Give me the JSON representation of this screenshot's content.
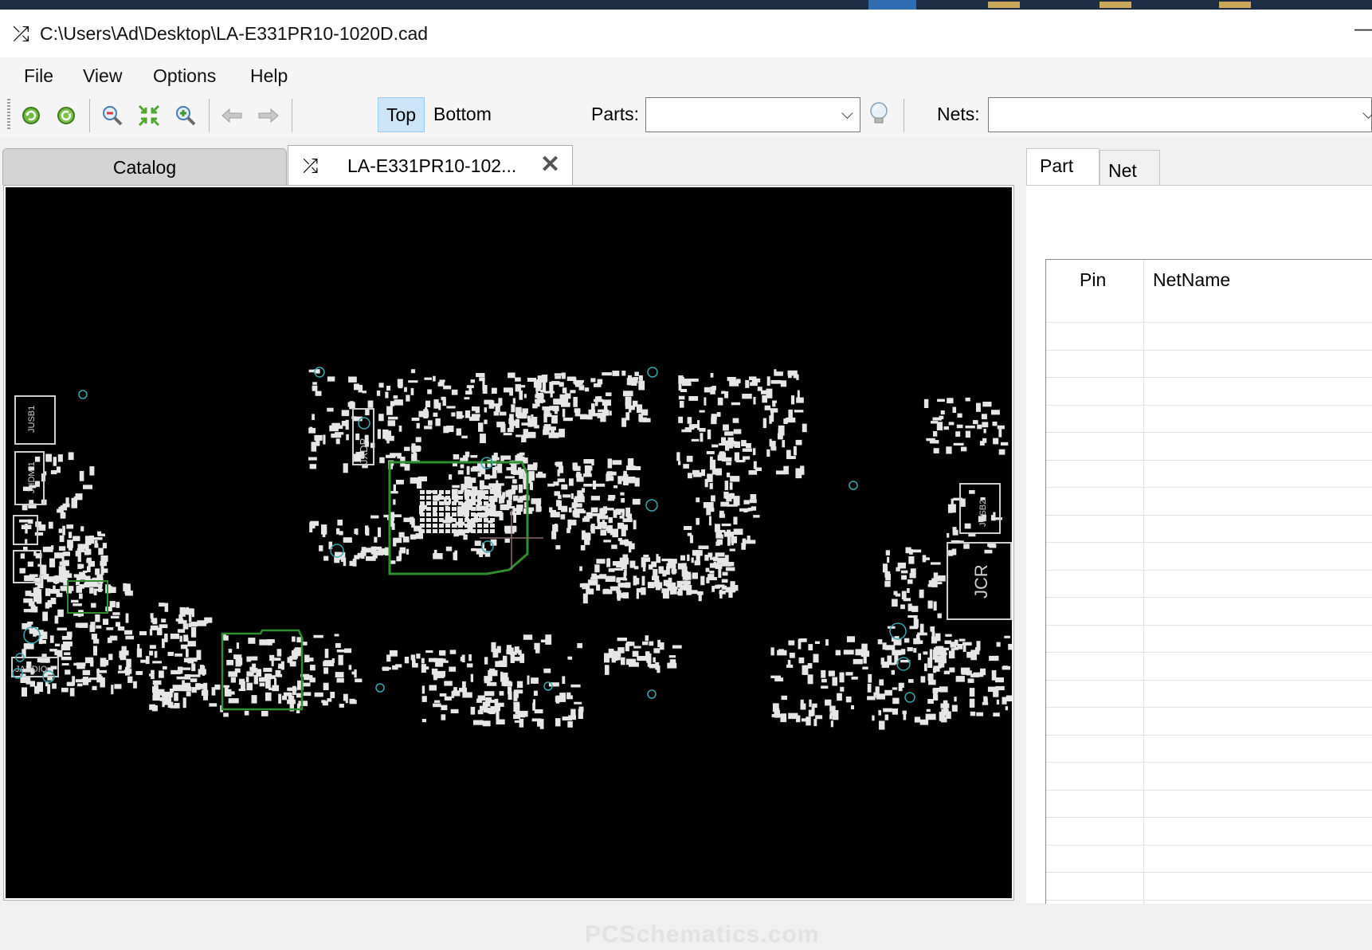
{
  "window": {
    "title": "C:\\Users\\Ad\\Desktop\\LA-E331PR10-1020D.cad",
    "app_icon": "shuffle-icon"
  },
  "menu": [
    "File",
    "View",
    "Options",
    "Help"
  ],
  "toolbar": {
    "buttons": [
      "refresh-icon",
      "reload-icon",
      "zoom-out-icon",
      "fit-icon",
      "zoom-in-icon",
      "back-arrow-icon",
      "forward-arrow-icon"
    ],
    "side_top": "Top",
    "side_bottom": "Bottom",
    "active_side": "Top",
    "parts_label": "Parts:",
    "parts_value": "",
    "nets_label": "Nets:",
    "nets_value": "",
    "highlight_icon": "lightbulb-icon"
  },
  "tabs": {
    "catalog": "Catalog",
    "document": "LA-E331PR10-102...",
    "close_icon": "close-icon"
  },
  "board_labels": [
    "JUSB1",
    "JHDMI1",
    "JAUDIO",
    "JXDP",
    "JUSB2",
    "JCR"
  ],
  "side_panel": {
    "tabs": [
      "Part",
      "Net"
    ],
    "active_tab": "Part",
    "columns": [
      "Pin",
      "NetName"
    ],
    "rows": []
  },
  "watermark": "PCSchematics.com",
  "colors": {
    "board_background": "#000000",
    "component": "#e6e6e6",
    "outline_green": "#2f8f2f",
    "via_cyan": "#3aa7b0",
    "active_toggle": "#cce4f7"
  }
}
